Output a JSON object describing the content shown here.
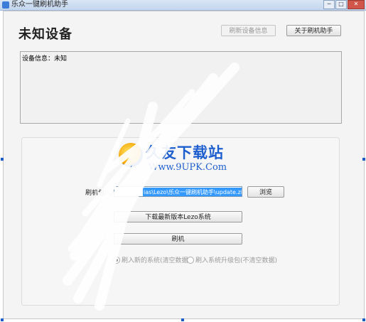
{
  "window": {
    "title": "乐众一键刷机助手",
    "controls": {
      "minimize": "─",
      "maximize": "□",
      "close": "✕"
    }
  },
  "header": {
    "device_title": "未知设备",
    "refresh_button": "刷新设备信息",
    "about_button": "关于刷机助手"
  },
  "info": {
    "text": "设备信息：未知"
  },
  "watermark": {
    "brand": "久友下载站",
    "url": "Www.9UPK.Com"
  },
  "flash": {
    "path_label": "刷机包:",
    "path_value": "ias\\Lezo\\乐众一键刷机助手\\update.zip",
    "browse_button": "浏览",
    "download_button": "下载最新版本Lezo系统",
    "flash_button": "刷机",
    "options": [
      {
        "label": "刷入新的系统(清空数据)",
        "selected": true
      },
      {
        "label": "刷入系统升级包(不清空数据)",
        "selected": false
      }
    ]
  },
  "colors": {
    "accent": "#3399ff",
    "logo_blue": "#1e5fcf",
    "logo_orange": "#f5a100"
  }
}
